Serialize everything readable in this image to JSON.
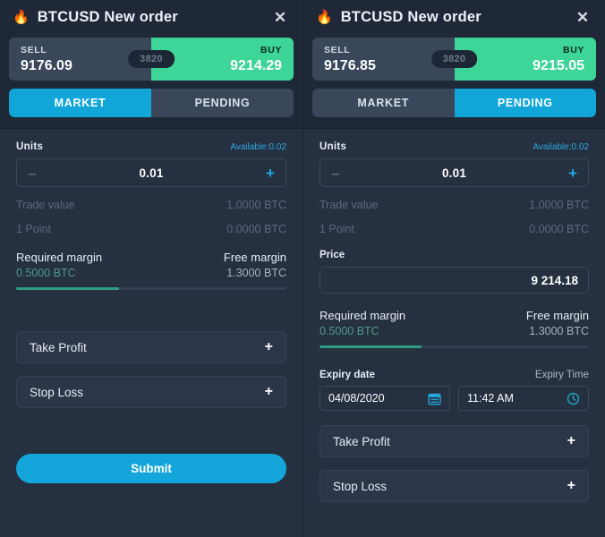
{
  "colors": {
    "panel_bg": "#253040",
    "header_bg": "#1e2836",
    "buy_green": "#3ed598",
    "sell_gray": "#3a475a",
    "accent_cyan": "#12a5d8",
    "margin_teal": "#2f9e83",
    "muted_text": "#5d6a7b"
  },
  "panels": [
    {
      "id": "market-panel",
      "header": {
        "icon": "flame-icon",
        "icon_glyph": "🔥",
        "title": "BTCUSD New order",
        "close_label": "✕"
      },
      "quote": {
        "sell_label": "SELL",
        "sell_price": "9176.09",
        "buy_label": "BUY",
        "buy_price": "9214.29",
        "spread": "3820"
      },
      "tabs": [
        {
          "label": "MARKET",
          "active": true
        },
        {
          "label": "PENDING",
          "active": false
        }
      ],
      "units": {
        "label": "Units",
        "available": "Available:0.02",
        "minus": "–",
        "value": "0.01",
        "plus": "+"
      },
      "info_rows": [
        {
          "label": "Trade value",
          "value": "1.0000 BTC"
        },
        {
          "label": "1 Point",
          "value": "0.0000 BTC"
        }
      ],
      "price": null,
      "margins": {
        "required_label": "Required margin",
        "required_value": "0.5000 BTC",
        "free_label": "Free margin",
        "free_value": "1.3000 BTC",
        "progress_percent": 38
      },
      "expiry": null,
      "tpsl": [
        {
          "label": "Take Profit",
          "plus": "+"
        },
        {
          "label": "Stop Loss",
          "plus": "+"
        }
      ],
      "submit": "Submit"
    },
    {
      "id": "pending-panel",
      "header": {
        "icon": "flame-icon",
        "icon_glyph": "🔥",
        "title": "BTCUSD New order",
        "close_label": "✕"
      },
      "quote": {
        "sell_label": "SELL",
        "sell_price": "9176.85",
        "buy_label": "BUY",
        "buy_price": "9215.05",
        "spread": "3820"
      },
      "tabs": [
        {
          "label": "MARKET",
          "active": false
        },
        {
          "label": "PENDING",
          "active": true
        }
      ],
      "units": {
        "label": "Units",
        "available": "Available:0.02",
        "minus": "–",
        "value": "0.01",
        "plus": "+"
      },
      "info_rows": [
        {
          "label": "Trade value",
          "value": "1.0000 BTC"
        },
        {
          "label": "1 Point",
          "value": "0.0000 BTC"
        }
      ],
      "price": {
        "label": "Price",
        "value": "9 214.18"
      },
      "margins": {
        "required_label": "Required margin",
        "required_value": "0.5000 BTC",
        "free_label": "Free margin",
        "free_value": "1.3000 BTC",
        "progress_percent": 38
      },
      "expiry": {
        "date_label": "Expiry date",
        "time_label": "Expiry Time",
        "date_value": "04/08/2020",
        "time_value": "11:42 AM",
        "date_icon": "calendar-icon",
        "time_icon": "clock-icon"
      },
      "tpsl": [
        {
          "label": "Take Profit",
          "plus": "+"
        },
        {
          "label": "Stop Loss",
          "plus": "+"
        }
      ],
      "submit": null
    }
  ]
}
